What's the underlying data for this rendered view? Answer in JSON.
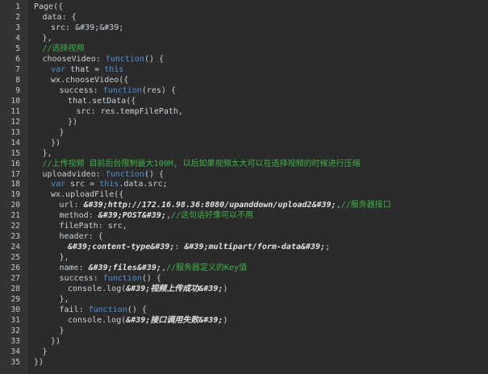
{
  "lines": [
    {
      "n": "1",
      "indent": 0,
      "parts": [
        [
          "plain",
          "Page({"
        ]
      ]
    },
    {
      "n": "2",
      "indent": 1,
      "parts": [
        [
          "plain",
          "data: {"
        ]
      ]
    },
    {
      "n": "3",
      "indent": 2,
      "parts": [
        [
          "plain",
          "src: &#39;&#39;"
        ]
      ]
    },
    {
      "n": "4",
      "indent": 1,
      "parts": [
        [
          "plain",
          "},"
        ]
      ]
    },
    {
      "n": "5",
      "indent": 1,
      "parts": [
        [
          "cm",
          "//选择视频"
        ]
      ]
    },
    {
      "n": "6",
      "indent": 1,
      "parts": [
        [
          "plain",
          "chooseVideo: "
        ],
        [
          "kw",
          "function"
        ],
        [
          "plain",
          "() {"
        ]
      ]
    },
    {
      "n": "7",
      "indent": 2,
      "parts": [
        [
          "kw",
          "var"
        ],
        [
          "plain",
          " that = "
        ],
        [
          "kw",
          "this"
        ]
      ]
    },
    {
      "n": "8",
      "indent": 2,
      "parts": [
        [
          "plain",
          "wx.chooseVideo({"
        ]
      ]
    },
    {
      "n": "9",
      "indent": 3,
      "parts": [
        [
          "plain",
          "success: "
        ],
        [
          "kw",
          "function"
        ],
        [
          "plain",
          "(res) {"
        ]
      ]
    },
    {
      "n": "10",
      "indent": 4,
      "parts": [
        [
          "plain",
          "that.setData({"
        ]
      ]
    },
    {
      "n": "11",
      "indent": 5,
      "parts": [
        [
          "plain",
          "src: res.tempFilePath,"
        ]
      ]
    },
    {
      "n": "12",
      "indent": 4,
      "parts": [
        [
          "plain",
          "})"
        ]
      ]
    },
    {
      "n": "13",
      "indent": 3,
      "parts": [
        [
          "plain",
          "}"
        ]
      ]
    },
    {
      "n": "14",
      "indent": 2,
      "parts": [
        [
          "plain",
          "})"
        ]
      ]
    },
    {
      "n": "15",
      "indent": 1,
      "parts": [
        [
          "plain",
          "},"
        ]
      ]
    },
    {
      "n": "16",
      "indent": 1,
      "parts": [
        [
          "cm",
          "//上传视频 目前后台限制最大100M, 以后如果视频太大可以在选择视频的时候进行压缩"
        ]
      ]
    },
    {
      "n": "17",
      "indent": 1,
      "parts": [
        [
          "plain",
          "uploadvideo: "
        ],
        [
          "kw",
          "function"
        ],
        [
          "plain",
          "() {"
        ]
      ]
    },
    {
      "n": "18",
      "indent": 2,
      "parts": [
        [
          "kw",
          "var"
        ],
        [
          "plain",
          " src = "
        ],
        [
          "kw",
          "this"
        ],
        [
          "plain",
          ".data.src;"
        ]
      ]
    },
    {
      "n": "19",
      "indent": 2,
      "parts": [
        [
          "plain",
          "wx.uploadFile({"
        ]
      ]
    },
    {
      "n": "20",
      "indent": 3,
      "parts": [
        [
          "plain",
          "url: "
        ],
        [
          "str",
          "&#39;http://172.16.98.36:8080/upanddown/upload2&#39;"
        ],
        [
          "plain",
          ","
        ],
        [
          "cm",
          "//服务器接口"
        ]
      ]
    },
    {
      "n": "21",
      "indent": 3,
      "parts": [
        [
          "plain",
          "method: "
        ],
        [
          "str",
          "&#39;POST&#39;"
        ],
        [
          "plain",
          ","
        ],
        [
          "cm",
          "//这句话好像可以不用"
        ]
      ]
    },
    {
      "n": "22",
      "indent": 3,
      "parts": [
        [
          "plain",
          "filePath: src,"
        ]
      ]
    },
    {
      "n": "23",
      "indent": 3,
      "parts": [
        [
          "plain",
          "header: {"
        ]
      ]
    },
    {
      "n": "24",
      "indent": 4,
      "parts": [
        [
          "str",
          "&#39;content-type&#39;"
        ],
        [
          "plain",
          ": "
        ],
        [
          "str",
          "&#39;multipart/form-data&#39;"
        ],
        [
          "plain",
          ";"
        ]
      ]
    },
    {
      "n": "25",
      "indent": 3,
      "parts": [
        [
          "plain",
          "},"
        ]
      ]
    },
    {
      "n": "26",
      "indent": 3,
      "parts": [
        [
          "plain",
          "name: "
        ],
        [
          "str",
          "&#39;files&#39;"
        ],
        [
          "plain",
          ","
        ],
        [
          "cm",
          "//服务器定义的Key值"
        ]
      ]
    },
    {
      "n": "27",
      "indent": 3,
      "parts": [
        [
          "plain",
          "success: "
        ],
        [
          "kw",
          "function"
        ],
        [
          "plain",
          "() {"
        ]
      ]
    },
    {
      "n": "28",
      "indent": 4,
      "parts": [
        [
          "plain",
          "console.log("
        ],
        [
          "str",
          "&#39;视频上传成功&#39;"
        ],
        [
          "plain",
          ")"
        ]
      ]
    },
    {
      "n": "29",
      "indent": 3,
      "parts": [
        [
          "plain",
          "},"
        ]
      ]
    },
    {
      "n": "30",
      "indent": 3,
      "parts": [
        [
          "plain",
          "fail: "
        ],
        [
          "kw",
          "function"
        ],
        [
          "plain",
          "() {"
        ]
      ]
    },
    {
      "n": "31",
      "indent": 4,
      "parts": [
        [
          "plain",
          "console.log("
        ],
        [
          "str",
          "&#39;接口调用失败&#39;"
        ],
        [
          "plain",
          ")"
        ]
      ]
    },
    {
      "n": "32",
      "indent": 3,
      "parts": [
        [
          "plain",
          "}"
        ]
      ]
    },
    {
      "n": "33",
      "indent": 2,
      "parts": [
        [
          "plain",
          "})"
        ]
      ]
    },
    {
      "n": "34",
      "indent": 1,
      "parts": [
        [
          "plain",
          "}"
        ]
      ]
    },
    {
      "n": "35",
      "indent": 0,
      "parts": [
        [
          "plain",
          "})"
        ]
      ]
    }
  ],
  "colors": {
    "background": "#2b2b2b",
    "gutter": "#313335",
    "keyword": "#4f8fd6",
    "comment": "#3fb24a",
    "string": "#e2e2e2",
    "text": "#c9d1d9",
    "line_number": "#c8c8c8"
  }
}
